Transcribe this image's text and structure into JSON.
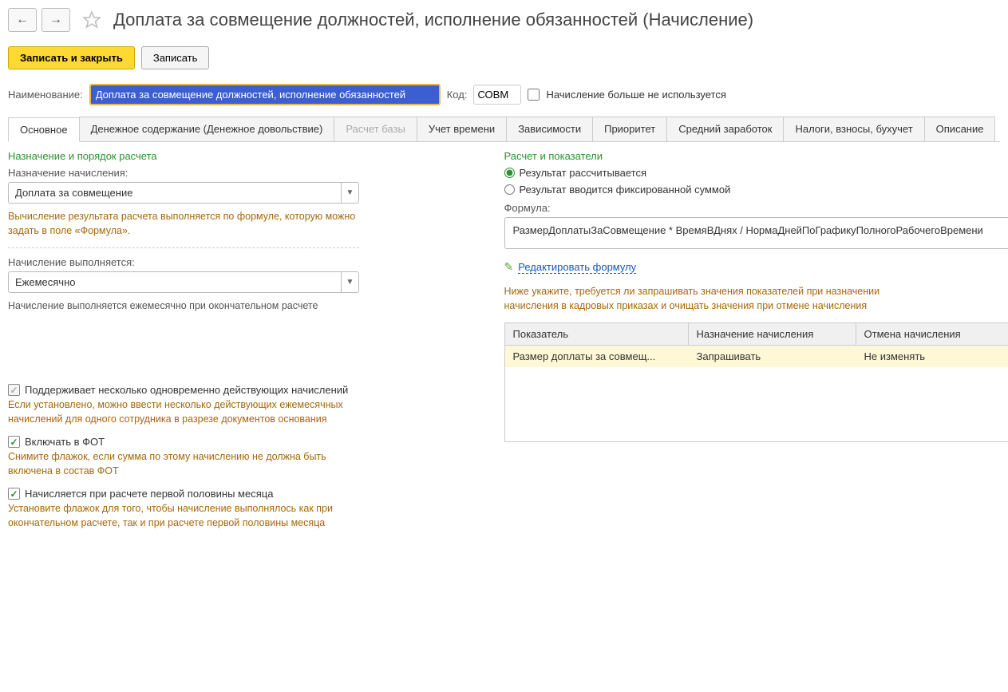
{
  "header": {
    "title": "Доплата за совмещение должностей, исполнение обязанностей (Начисление)"
  },
  "toolbar": {
    "save_close": "Записать и закрыть",
    "save": "Записать"
  },
  "fields": {
    "name_label": "Наименование:",
    "name_value": "Доплата за совмещение должностей, исполнение обязанностей",
    "code_label": "Код:",
    "code_value": "СОВМ",
    "archived_label": "Начисление больше не используется"
  },
  "tabs": [
    "Основное",
    "Денежное содержание (Денежное довольствие)",
    "Расчет базы",
    "Учет времени",
    "Зависимости",
    "Приоритет",
    "Средний заработок",
    "Налоги, взносы, бухучет",
    "Описание"
  ],
  "left": {
    "section": "Назначение и порядок расчета",
    "purpose_label": "Назначение начисления:",
    "purpose_value": "Доплата за совмещение",
    "purpose_hint": "Вычисление результата расчета выполняется по формуле, которую можно задать в поле «Формула».",
    "period_label": "Начисление выполняется:",
    "period_value": "Ежемесячно",
    "period_hint": "Начисление выполняется ежемесячно при окончательном расчете"
  },
  "right": {
    "section": "Расчет и показатели",
    "radio1": "Результат рассчитывается",
    "radio2": "Результат вводится фиксированной суммой",
    "formula_label": "Формула:",
    "formula_value": "РазмерДоплатыЗаСовмещение * ВремяВДнях / НормаДнейПоГрафикуПолногоРабочегоВремени",
    "edit_link": "Редактировать формулу",
    "hint": "Ниже укажите, требуется ли запрашивать значения показателей при назначении начисления в кадровых приказах и очищать значения при отмене начисления",
    "table": {
      "col1": "Показатель",
      "col2": "Назначение начисления",
      "col3": "Отмена начисления",
      "row": {
        "c1": "Размер доплаты за совмещ...",
        "c2": "Запрашивать",
        "c3": "Не изменять"
      }
    }
  },
  "checks": {
    "c1": "Поддерживает несколько одновременно действующих начислений",
    "h1": "Если установлено, можно ввести несколько действующих ежемесячных начислений для одного сотрудника в разрезе документов основания",
    "c2": "Включать в ФОТ",
    "h2": "Снимите флажок, если сумма по этому начислению не должна быть включена в состав ФОТ",
    "c3": "Начисляется при расчете первой половины месяца",
    "h3": "Установите флажок для того, чтобы начисление выполнялось как при окончательном расчете, так и при расчете первой половины месяца"
  }
}
